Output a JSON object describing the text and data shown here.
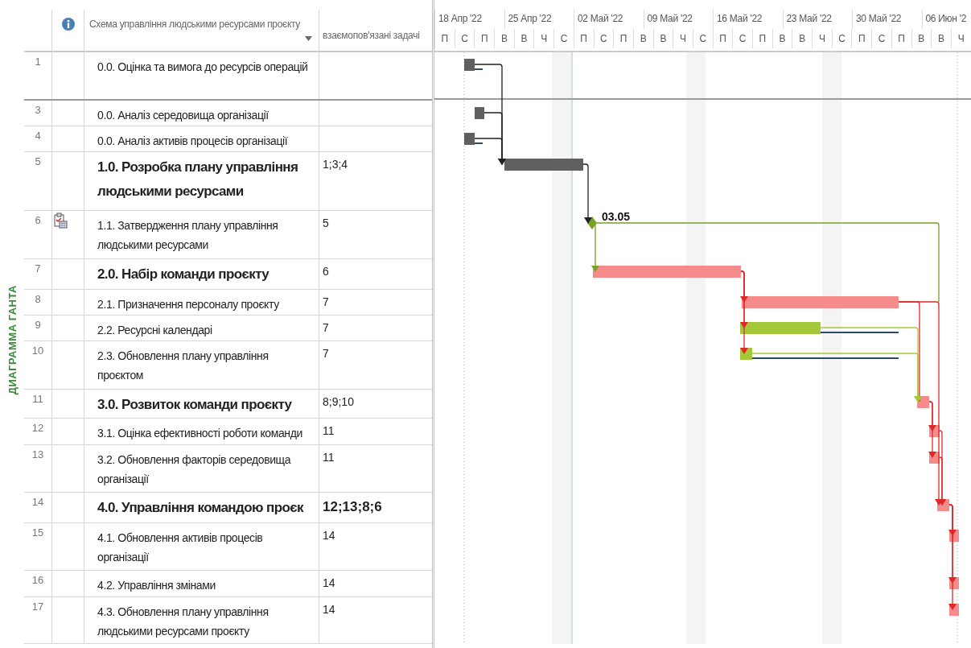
{
  "side_label": "ДИАГРАММА ГАНТА",
  "columns": {
    "name": "Схема управління людськими ресурсами проєкту",
    "predecessors": "взаємопов'язані задачі"
  },
  "timescale": {
    "weeks": [
      "18 Апр '22",
      "25 Апр '22",
      "02 Май '22",
      "09 Май '22",
      "16 Май '22",
      "23 Май '22",
      "30 Май '22",
      "06 Июн '2"
    ],
    "days": [
      "П",
      "С",
      "П",
      "В",
      "В",
      "Ч",
      "С",
      "П",
      "С",
      "П",
      "В",
      "В",
      "Ч",
      "С",
      "П",
      "С",
      "П",
      "В",
      "В",
      "Ч",
      "С",
      "П",
      "С",
      "П",
      "В",
      "В",
      "Ч"
    ]
  },
  "rows": [
    {
      "id": "1",
      "name": "0.0. Оцінка та вимога до ресурсів операцій",
      "kind": "task",
      "indicator": false,
      "bar": {
        "kind": "summary"
      }
    },
    {
      "id": "3",
      "name": "0.0. Аналіз середовища організації",
      "kind": "task",
      "indicator": false,
      "bar": {
        "kind": "summary"
      }
    },
    {
      "id": "4",
      "name": "0.0. Аналіз активів процесів організації",
      "kind": "task",
      "indicator": false,
      "bar": {
        "kind": "summary"
      }
    },
    {
      "id": "5",
      "name": "1.0. Розробка плану управління людськими ресурсами",
      "kind": "summary",
      "indicator": false,
      "predecessors": "1;3;4",
      "predecessors_bold": false,
      "bar": {
        "kind": "summary"
      }
    },
    {
      "id": "6",
      "name": "1.1. Затвердження плану управління людськими ресурсами",
      "kind": "task",
      "indicator": true,
      "predecessors": "5",
      "predecessors_bold": false,
      "bar": {
        "kind": "milestone",
        "label": "03.05"
      }
    },
    {
      "id": "7",
      "name": "2.0. Набір команди проєкту",
      "kind": "summary",
      "indicator": false,
      "predecessors": "6",
      "predecessors_bold": false,
      "bar": {
        "kind": "critical"
      }
    },
    {
      "id": "8",
      "name": "2.1. Призначення персоналу проєкту",
      "kind": "task",
      "indicator": false,
      "predecessors": "7",
      "predecessors_bold": false,
      "bar": {
        "kind": "critical"
      }
    },
    {
      "id": "9",
      "name": "2.2. Ресурсні календарі",
      "kind": "task",
      "indicator": false,
      "predecessors": "7",
      "predecessors_bold": false,
      "bar": {
        "kind": "normal"
      }
    },
    {
      "id": "10",
      "name": "2.3. Обновлення плану управління проєктом",
      "kind": "task",
      "indicator": false,
      "predecessors": "7",
      "predecessors_bold": false,
      "bar": {
        "kind": "normal"
      }
    },
    {
      "id": "11",
      "name": "3.0. Розвиток команди проєкту",
      "kind": "summary",
      "indicator": false,
      "predecessors": "8;9;10",
      "predecessors_bold": false,
      "bar": {
        "kind": "critical"
      }
    },
    {
      "id": "12",
      "name": "3.1. Оцінка ефективності роботи команди",
      "kind": "task",
      "indicator": false,
      "predecessors": "11",
      "predecessors_bold": false,
      "bar": {
        "kind": "critical"
      }
    },
    {
      "id": "13",
      "name": "3.2. Обновлення факторів середовища організації",
      "kind": "task",
      "indicator": false,
      "predecessors": "11",
      "predecessors_bold": false,
      "bar": {
        "kind": "critical"
      }
    },
    {
      "id": "14",
      "name": "4.0. Управління командою проєк",
      "kind": "summary",
      "indicator": false,
      "predecessors": "12;13;8;6",
      "predecessors_bold": true,
      "bar": {
        "kind": "critical"
      }
    },
    {
      "id": "15",
      "name": "4.1. Обновлення активів процесів організації",
      "kind": "task",
      "indicator": false,
      "predecessors": "14",
      "predecessors_bold": false,
      "bar": {
        "kind": "critical"
      }
    },
    {
      "id": "16",
      "name": "4.2. Управління змінами",
      "kind": "task",
      "indicator": false,
      "predecessors": "14",
      "predecessors_bold": false,
      "bar": {
        "kind": "critical"
      }
    },
    {
      "id": "17",
      "name": "4.3. Обновлення плану управління людськими ресурсами проєкту",
      "kind": "task",
      "indicator": false,
      "predecessors": "14",
      "predecessors_bold": false,
      "bar": {
        "kind": "critical"
      }
    }
  ]
}
